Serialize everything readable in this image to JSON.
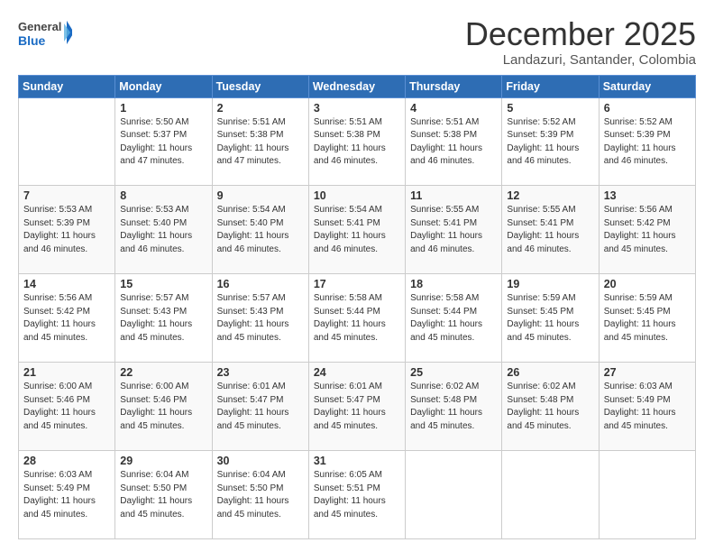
{
  "header": {
    "logo_line1": "General",
    "logo_line2": "Blue",
    "month": "December 2025",
    "location": "Landazuri, Santander, Colombia"
  },
  "weekdays": [
    "Sunday",
    "Monday",
    "Tuesday",
    "Wednesday",
    "Thursday",
    "Friday",
    "Saturday"
  ],
  "weeks": [
    [
      {
        "day": "",
        "content": ""
      },
      {
        "day": "1",
        "content": "Sunrise: 5:50 AM\nSunset: 5:37 PM\nDaylight: 11 hours\nand 47 minutes."
      },
      {
        "day": "2",
        "content": "Sunrise: 5:51 AM\nSunset: 5:38 PM\nDaylight: 11 hours\nand 47 minutes."
      },
      {
        "day": "3",
        "content": "Sunrise: 5:51 AM\nSunset: 5:38 PM\nDaylight: 11 hours\nand 46 minutes."
      },
      {
        "day": "4",
        "content": "Sunrise: 5:51 AM\nSunset: 5:38 PM\nDaylight: 11 hours\nand 46 minutes."
      },
      {
        "day": "5",
        "content": "Sunrise: 5:52 AM\nSunset: 5:39 PM\nDaylight: 11 hours\nand 46 minutes."
      },
      {
        "day": "6",
        "content": "Sunrise: 5:52 AM\nSunset: 5:39 PM\nDaylight: 11 hours\nand 46 minutes."
      }
    ],
    [
      {
        "day": "7",
        "content": "Sunrise: 5:53 AM\nSunset: 5:39 PM\nDaylight: 11 hours\nand 46 minutes."
      },
      {
        "day": "8",
        "content": "Sunrise: 5:53 AM\nSunset: 5:40 PM\nDaylight: 11 hours\nand 46 minutes."
      },
      {
        "day": "9",
        "content": "Sunrise: 5:54 AM\nSunset: 5:40 PM\nDaylight: 11 hours\nand 46 minutes."
      },
      {
        "day": "10",
        "content": "Sunrise: 5:54 AM\nSunset: 5:41 PM\nDaylight: 11 hours\nand 46 minutes."
      },
      {
        "day": "11",
        "content": "Sunrise: 5:55 AM\nSunset: 5:41 PM\nDaylight: 11 hours\nand 46 minutes."
      },
      {
        "day": "12",
        "content": "Sunrise: 5:55 AM\nSunset: 5:41 PM\nDaylight: 11 hours\nand 46 minutes."
      },
      {
        "day": "13",
        "content": "Sunrise: 5:56 AM\nSunset: 5:42 PM\nDaylight: 11 hours\nand 45 minutes."
      }
    ],
    [
      {
        "day": "14",
        "content": "Sunrise: 5:56 AM\nSunset: 5:42 PM\nDaylight: 11 hours\nand 45 minutes."
      },
      {
        "day": "15",
        "content": "Sunrise: 5:57 AM\nSunset: 5:43 PM\nDaylight: 11 hours\nand 45 minutes."
      },
      {
        "day": "16",
        "content": "Sunrise: 5:57 AM\nSunset: 5:43 PM\nDaylight: 11 hours\nand 45 minutes."
      },
      {
        "day": "17",
        "content": "Sunrise: 5:58 AM\nSunset: 5:44 PM\nDaylight: 11 hours\nand 45 minutes."
      },
      {
        "day": "18",
        "content": "Sunrise: 5:58 AM\nSunset: 5:44 PM\nDaylight: 11 hours\nand 45 minutes."
      },
      {
        "day": "19",
        "content": "Sunrise: 5:59 AM\nSunset: 5:45 PM\nDaylight: 11 hours\nand 45 minutes."
      },
      {
        "day": "20",
        "content": "Sunrise: 5:59 AM\nSunset: 5:45 PM\nDaylight: 11 hours\nand 45 minutes."
      }
    ],
    [
      {
        "day": "21",
        "content": "Sunrise: 6:00 AM\nSunset: 5:46 PM\nDaylight: 11 hours\nand 45 minutes."
      },
      {
        "day": "22",
        "content": "Sunrise: 6:00 AM\nSunset: 5:46 PM\nDaylight: 11 hours\nand 45 minutes."
      },
      {
        "day": "23",
        "content": "Sunrise: 6:01 AM\nSunset: 5:47 PM\nDaylight: 11 hours\nand 45 minutes."
      },
      {
        "day": "24",
        "content": "Sunrise: 6:01 AM\nSunset: 5:47 PM\nDaylight: 11 hours\nand 45 minutes."
      },
      {
        "day": "25",
        "content": "Sunrise: 6:02 AM\nSunset: 5:48 PM\nDaylight: 11 hours\nand 45 minutes."
      },
      {
        "day": "26",
        "content": "Sunrise: 6:02 AM\nSunset: 5:48 PM\nDaylight: 11 hours\nand 45 minutes."
      },
      {
        "day": "27",
        "content": "Sunrise: 6:03 AM\nSunset: 5:49 PM\nDaylight: 11 hours\nand 45 minutes."
      }
    ],
    [
      {
        "day": "28",
        "content": "Sunrise: 6:03 AM\nSunset: 5:49 PM\nDaylight: 11 hours\nand 45 minutes."
      },
      {
        "day": "29",
        "content": "Sunrise: 6:04 AM\nSunset: 5:50 PM\nDaylight: 11 hours\nand 45 minutes."
      },
      {
        "day": "30",
        "content": "Sunrise: 6:04 AM\nSunset: 5:50 PM\nDaylight: 11 hours\nand 45 minutes."
      },
      {
        "day": "31",
        "content": "Sunrise: 6:05 AM\nSunset: 5:51 PM\nDaylight: 11 hours\nand 45 minutes."
      },
      {
        "day": "",
        "content": ""
      },
      {
        "day": "",
        "content": ""
      },
      {
        "day": "",
        "content": ""
      }
    ]
  ]
}
